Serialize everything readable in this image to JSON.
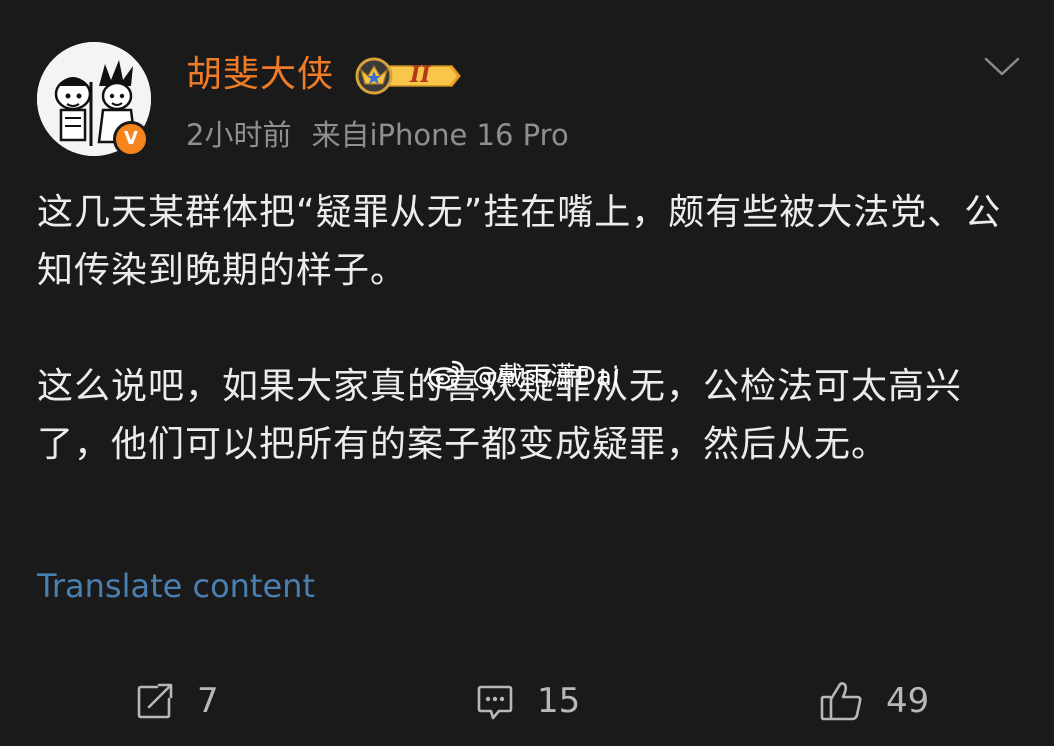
{
  "post": {
    "author": {
      "name": "胡斐大侠",
      "vip_level": "II",
      "verified_mark": "V",
      "avatar_icon": "cartoon-avatar-icon"
    },
    "meta": {
      "time": "2小时前",
      "source": "来自iPhone 16 Pro"
    },
    "paragraphs": [
      "这几天某群体把“疑罪从无”挂在嘴上，颇有些被大法党、公知传染到晚期的样子。",
      "这么说吧，如果大家真的喜欢疑罪从无，公检法可太高兴了，他们可以把所有的案子都变成疑罪，然后从无。"
    ],
    "watermark": "@戴雨潇Dai",
    "translate_link": "Translate content",
    "actions": {
      "repost": {
        "icon": "repost-icon",
        "count": "7"
      },
      "comment": {
        "icon": "comment-icon",
        "count": "15"
      },
      "like": {
        "icon": "thumbs-up-icon",
        "count": "49"
      }
    }
  },
  "colors": {
    "background": "#1a1a1a",
    "username": "#f07c29",
    "verified": "#f5841f",
    "link": "#4a7fb1",
    "meta": "#8f8f8f"
  }
}
